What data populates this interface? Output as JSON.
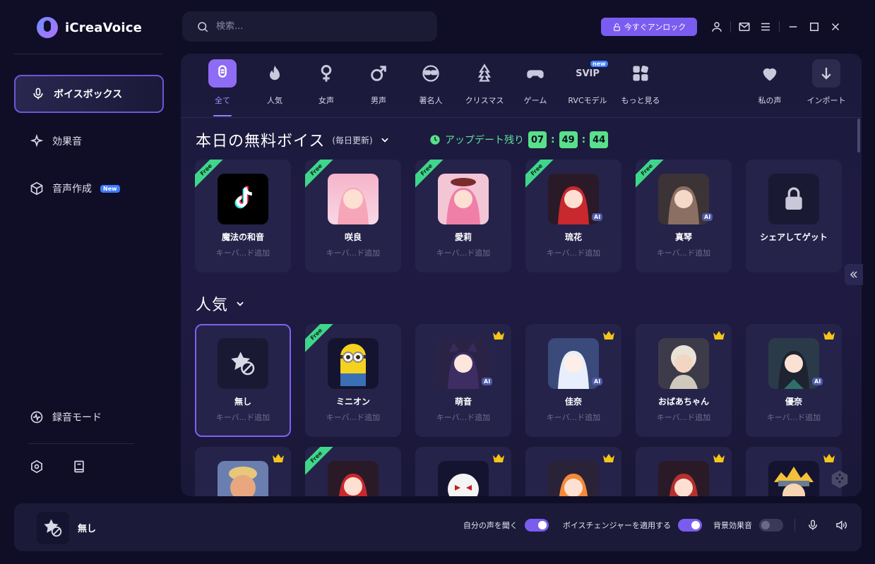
{
  "app": {
    "name": "iCreaVoice"
  },
  "search": {
    "placeholder": "検索..."
  },
  "header": {
    "unlock_label": "今すぐアンロック",
    "icons": [
      "user-icon",
      "mail-icon",
      "menu-icon",
      "minimize-icon",
      "maximize-icon",
      "close-icon"
    ]
  },
  "sidebar": {
    "items": [
      {
        "label": "ボイスボックス",
        "icon": "mic-icon",
        "active": true
      },
      {
        "label": "効果音",
        "icon": "sparkle-icon"
      },
      {
        "label": "音声作成",
        "icon": "cube-icon",
        "badge": "New"
      },
      {
        "label": "録音モード",
        "icon": "waveform-icon"
      }
    ],
    "bottom_icons": [
      "settings-icon",
      "book-icon"
    ]
  },
  "categories": [
    {
      "label": "全て",
      "icon": "mic-icon",
      "active": true
    },
    {
      "label": "人気",
      "icon": "fire-icon"
    },
    {
      "label": "女声",
      "icon": "female-icon"
    },
    {
      "label": "男声",
      "icon": "male-icon"
    },
    {
      "label": "著名人",
      "icon": "celebrity-icon"
    },
    {
      "label": "クリスマス",
      "icon": "christmas-tree-icon"
    },
    {
      "label": "ゲーム",
      "icon": "gamepad-icon"
    },
    {
      "label": "RVCモデル",
      "icon": "svip-icon",
      "svip_text": "SVIP",
      "badge": "new"
    },
    {
      "label": "もっと見る",
      "icon": "grid-icon"
    },
    {
      "label": "私の声",
      "icon": "heart-icon"
    },
    {
      "label": "インポート",
      "icon": "download-icon"
    }
  ],
  "free_section": {
    "title": "本日の無料ボイス",
    "subtitle": "(毎日更新)",
    "timer_label": "アップデート残り",
    "timer": {
      "h": "07",
      "m": "49",
      "s": "44"
    },
    "cards": [
      {
        "name": "魔法の和音",
        "keyword": "キーバ...ド追加",
        "free": "Free",
        "avatar": "tiktok"
      },
      {
        "name": "咲良",
        "keyword": "キーバ...ド追加",
        "free": "Free",
        "avatar": "anime-girl"
      },
      {
        "name": "愛莉",
        "keyword": "キーバ...ド追加",
        "free": "Free",
        "avatar": "anime-girl-pink"
      },
      {
        "name": "琉花",
        "keyword": "キーバ...ド追加",
        "free": "Free",
        "avatar": "anime-girl-red",
        "ai": "AI"
      },
      {
        "name": "真琴",
        "keyword": "キーバ...ド追加",
        "free": "Free",
        "avatar": "anime-girl-brown",
        "ai": "AI"
      },
      {
        "name": "シェアしてゲット",
        "keyword": "",
        "avatar": "lock"
      }
    ]
  },
  "popular_section": {
    "title": "人気",
    "cards": [
      {
        "name": "無し",
        "keyword": "キーバ...ド追加",
        "avatar": "no-effect",
        "selected": true
      },
      {
        "name": "ミニオン",
        "keyword": "キーバ...ド追加",
        "free": "Free",
        "avatar": "minion"
      },
      {
        "name": "萌音",
        "keyword": "キーバ...ド追加",
        "crown": true,
        "avatar": "anime-cat-girl",
        "ai": "AI"
      },
      {
        "name": "佳奈",
        "keyword": "キーバ...ド追加",
        "crown": true,
        "avatar": "anime-white-girl",
        "ai": "AI"
      },
      {
        "name": "おばあちゃん",
        "keyword": "キーバ...ド追加",
        "crown": true,
        "avatar": "grandma"
      },
      {
        "name": "優奈",
        "keyword": "キーバ...ド追加",
        "crown": true,
        "avatar": "anime-dark-girl",
        "ai": "AI"
      }
    ],
    "row3": [
      {
        "avatar": "trump",
        "crown": true
      },
      {
        "avatar": "anime-girl-red",
        "free": "Free"
      },
      {
        "avatar": "skull-mask",
        "crown": true
      },
      {
        "avatar": "anime-girl-orange",
        "crown": true
      },
      {
        "avatar": "anime-girl-red2",
        "crown": true
      },
      {
        "avatar": "naruto",
        "crown": true
      }
    ]
  },
  "bottom_bar": {
    "current_voice": "無し",
    "listen_label": "自分の声を聞く",
    "listen_on": true,
    "changer_label": "ボイスチェンジャーを適用する",
    "changer_on": true,
    "bg_label": "背景効果音",
    "bg_on": false
  },
  "colors": {
    "accent": "#7b5cf0",
    "free": "#3fd68b",
    "timer": "#59e08a",
    "crown": "#f5c518"
  }
}
